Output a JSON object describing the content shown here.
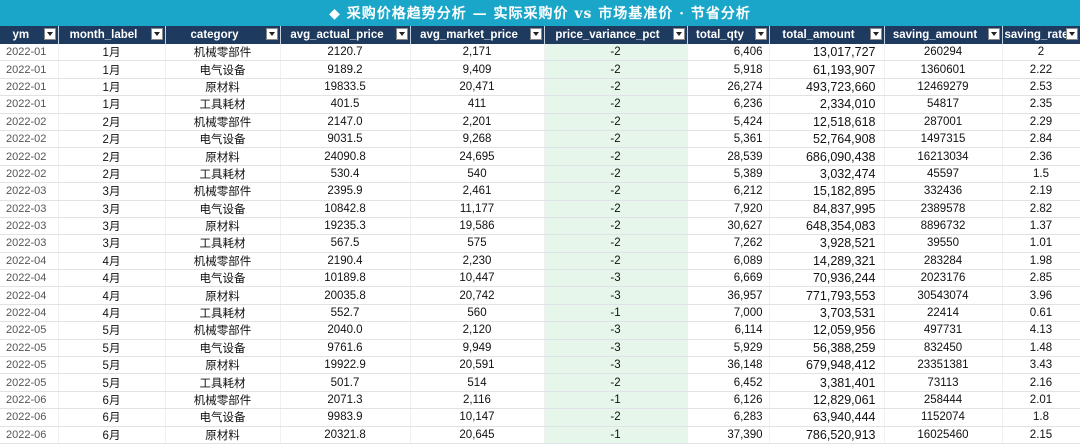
{
  "title": "◆  采购价格趋势分析  —  实际采购价 vs 市场基准价 · 节省分析",
  "columns": [
    "ym",
    "month_label",
    "category",
    "avg_actual_price",
    "avg_market_price",
    "price_variance_pct",
    "total_qty",
    "total_amount",
    "saving_amount",
    "saving_rate"
  ],
  "rows": [
    [
      "2022-01",
      "1月",
      "机械零部件",
      "2120.7",
      "2,171",
      "-2",
      "6,406",
      "13,017,727",
      "260294",
      "2"
    ],
    [
      "2022-01",
      "1月",
      "电气设备",
      "9189.2",
      "9,409",
      "-2",
      "5,918",
      "61,193,907",
      "1360601",
      "2.22"
    ],
    [
      "2022-01",
      "1月",
      "原材料",
      "19833.5",
      "20,471",
      "-2",
      "26,274",
      "493,723,660",
      "12469279",
      "2.53"
    ],
    [
      "2022-01",
      "1月",
      "工具耗材",
      "401.5",
      "411",
      "-2",
      "6,236",
      "2,334,010",
      "54817",
      "2.35"
    ],
    [
      "2022-02",
      "2月",
      "机械零部件",
      "2147.0",
      "2,201",
      "-2",
      "5,424",
      "12,518,618",
      "287001",
      "2.29"
    ],
    [
      "2022-02",
      "2月",
      "电气设备",
      "9031.5",
      "9,268",
      "-2",
      "5,361",
      "52,764,908",
      "1497315",
      "2.84"
    ],
    [
      "2022-02",
      "2月",
      "原材料",
      "24090.8",
      "24,695",
      "-2",
      "28,539",
      "686,090,438",
      "16213034",
      "2.36"
    ],
    [
      "2022-02",
      "2月",
      "工具耗材",
      "530.4",
      "540",
      "-2",
      "5,389",
      "3,032,474",
      "45597",
      "1.5"
    ],
    [
      "2022-03",
      "3月",
      "机械零部件",
      "2395.9",
      "2,461",
      "-2",
      "6,212",
      "15,182,895",
      "332436",
      "2.19"
    ],
    [
      "2022-03",
      "3月",
      "电气设备",
      "10842.8",
      "11,177",
      "-2",
      "7,920",
      "84,837,995",
      "2389578",
      "2.82"
    ],
    [
      "2022-03",
      "3月",
      "原材料",
      "19235.3",
      "19,586",
      "-2",
      "30,627",
      "648,354,083",
      "8896732",
      "1.37"
    ],
    [
      "2022-03",
      "3月",
      "工具耗材",
      "567.5",
      "575",
      "-2",
      "7,262",
      "3,928,521",
      "39550",
      "1.01"
    ],
    [
      "2022-04",
      "4月",
      "机械零部件",
      "2190.4",
      "2,230",
      "-2",
      "6,089",
      "14,289,321",
      "283284",
      "1.98"
    ],
    [
      "2022-04",
      "4月",
      "电气设备",
      "10189.8",
      "10,447",
      "-3",
      "6,669",
      "70,936,244",
      "2023176",
      "2.85"
    ],
    [
      "2022-04",
      "4月",
      "原材料",
      "20035.8",
      "20,742",
      "-3",
      "36,957",
      "771,793,553",
      "30543074",
      "3.96"
    ],
    [
      "2022-04",
      "4月",
      "工具耗材",
      "552.7",
      "560",
      "-1",
      "7,000",
      "3,703,531",
      "22414",
      "0.61"
    ],
    [
      "2022-05",
      "5月",
      "机械零部件",
      "2040.0",
      "2,120",
      "-3",
      "6,114",
      "12,059,956",
      "497731",
      "4.13"
    ],
    [
      "2022-05",
      "5月",
      "电气设备",
      "9761.6",
      "9,949",
      "-3",
      "5,929",
      "56,388,259",
      "832450",
      "1.48"
    ],
    [
      "2022-05",
      "5月",
      "原材料",
      "19922.9",
      "20,591",
      "-3",
      "36,148",
      "679,948,412",
      "23351381",
      "3.43"
    ],
    [
      "2022-05",
      "5月",
      "工具耗材",
      "501.7",
      "514",
      "-2",
      "6,452",
      "3,381,401",
      "73113",
      "2.16"
    ],
    [
      "2022-06",
      "6月",
      "机械零部件",
      "2071.3",
      "2,116",
      "-1",
      "6,126",
      "12,829,061",
      "258444",
      "2.01"
    ],
    [
      "2022-06",
      "6月",
      "电气设备",
      "9983.9",
      "10,147",
      "-2",
      "6,283",
      "63,940,444",
      "1152074",
      "1.8"
    ],
    [
      "2022-06",
      "6月",
      "原材料",
      "20321.8",
      "20,645",
      "-1",
      "37,390",
      "786,520,913",
      "16025460",
      "2.15"
    ]
  ]
}
